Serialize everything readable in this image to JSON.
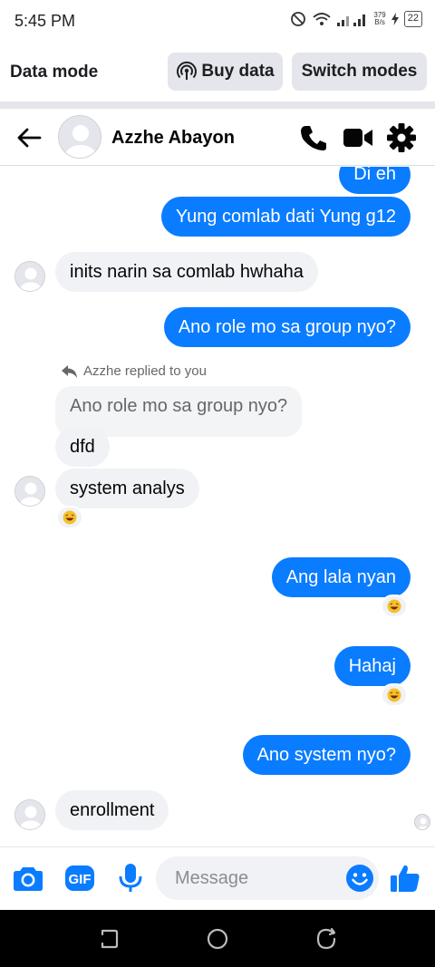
{
  "status_bar": {
    "time": "5:45 PM",
    "net_speed_value": "379",
    "net_speed_unit": "B/s",
    "battery": "22"
  },
  "data_mode": {
    "title": "Data mode",
    "buy_label": "Buy data",
    "switch_label": "Switch modes"
  },
  "header": {
    "contact_name": "Azzhe Abayon"
  },
  "messages": {
    "out_1": "Di eh",
    "out_2": "Yung comlab dati Yung g12",
    "in_1": "inits narin sa comlab hwhaha",
    "out_3": "Ano role mo sa group nyo?",
    "reply_note": "Azzhe replied to you",
    "quoted": "Ano role mo sa group nyo?",
    "in_2": "dfd",
    "in_3": "system analys",
    "out_4": "Ang lala nyan",
    "out_5": "Hahaj",
    "out_6": "Ano system nyo?",
    "in_4": "enrollment"
  },
  "composer": {
    "placeholder": "Message",
    "gif_label": "GIF"
  },
  "colors": {
    "accent": "#0a7cff",
    "incoming_bubble": "#f0f2f5",
    "divider": "#e4e6eb"
  },
  "icons": [
    "back-arrow-icon",
    "phone-icon",
    "video-icon",
    "gear-icon",
    "camera-icon",
    "gif-icon",
    "microphone-icon",
    "emoji-icon",
    "thumbs-up-icon",
    "laugh-reaction-icon",
    "reply-icon",
    "broadcast-icon"
  ]
}
